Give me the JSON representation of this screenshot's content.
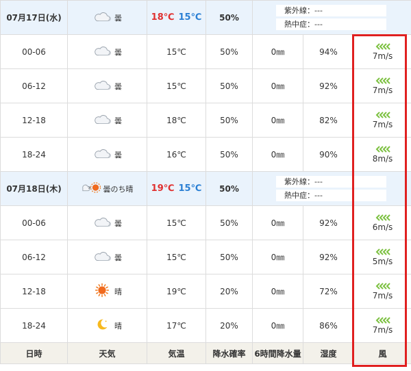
{
  "colors": {
    "accent_red": "#e02020",
    "temp_high": "#e03030",
    "temp_low": "#2a7fd4",
    "day_row_bg": "#eaf3fc",
    "footer_bg": "#f3f1ea",
    "wind_arrow": "#7dc142"
  },
  "days": [
    {
      "date": "07月17日(水)",
      "weather": {
        "icon": "cloud-icon",
        "label": "曇"
      },
      "temp_high": "18℃",
      "temp_low": "15℃",
      "pop": "50%",
      "uv_label": "紫外線：---",
      "heat_label": "熱中症：---",
      "hours": [
        {
          "time": "00-06",
          "icon": "cloud-icon",
          "label": "曇",
          "temp": "15℃",
          "pop": "50%",
          "rain": "0㎜",
          "humidity": "94%",
          "wind": "7m/s"
        },
        {
          "time": "06-12",
          "icon": "cloud-icon",
          "label": "曇",
          "temp": "15℃",
          "pop": "50%",
          "rain": "0㎜",
          "humidity": "92%",
          "wind": "7m/s"
        },
        {
          "time": "12-18",
          "icon": "cloud-icon",
          "label": "曇",
          "temp": "18℃",
          "pop": "50%",
          "rain": "0㎜",
          "humidity": "82%",
          "wind": "7m/s"
        },
        {
          "time": "18-24",
          "icon": "cloud-icon",
          "label": "曇",
          "temp": "16℃",
          "pop": "50%",
          "rain": "0㎜",
          "humidity": "90%",
          "wind": "8m/s"
        }
      ]
    },
    {
      "date": "07月18日(木)",
      "weather": {
        "icon": "cloud-then-sun-icon",
        "label": "曇のち晴"
      },
      "temp_high": "19℃",
      "temp_low": "15℃",
      "pop": "50%",
      "uv_label": "紫外線：---",
      "heat_label": "熱中症：---",
      "hours": [
        {
          "time": "00-06",
          "icon": "cloud-icon",
          "label": "曇",
          "temp": "15℃",
          "pop": "50%",
          "rain": "0㎜",
          "humidity": "92%",
          "wind": "6m/s"
        },
        {
          "time": "06-12",
          "icon": "cloud-icon",
          "label": "曇",
          "temp": "15℃",
          "pop": "50%",
          "rain": "0㎜",
          "humidity": "92%",
          "wind": "5m/s"
        },
        {
          "time": "12-18",
          "icon": "sun-icon",
          "label": "晴",
          "temp": "19℃",
          "pop": "20%",
          "rain": "0㎜",
          "humidity": "72%",
          "wind": "7m/s"
        },
        {
          "time": "18-24",
          "icon": "moon-icon",
          "label": "晴",
          "temp": "17℃",
          "pop": "20%",
          "rain": "0㎜",
          "humidity": "86%",
          "wind": "7m/s"
        }
      ]
    }
  ],
  "footer": {
    "date": "日時",
    "weather": "天気",
    "temp": "気温",
    "pop": "降水確率",
    "rain": "6時間降水量",
    "humidity": "湿度",
    "wind": "風"
  }
}
